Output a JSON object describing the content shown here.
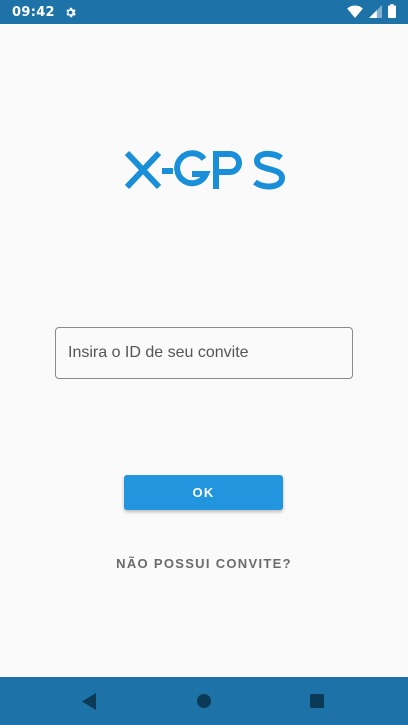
{
  "status_bar": {
    "time": "09:42",
    "icons": [
      "settings-icon",
      "wifi-icon",
      "signal-icon",
      "battery-icon"
    ]
  },
  "logo": {
    "text": "X-GPS",
    "color": "#1a8fd9"
  },
  "invite": {
    "placeholder": "Insira o ID de seu convite",
    "value": ""
  },
  "actions": {
    "ok_label": "OK",
    "no_invite_label": "NÃO POSSUI CONVITE?"
  },
  "nav_bar": {
    "icons": [
      "back-icon",
      "home-icon",
      "recents-icon"
    ]
  },
  "colors": {
    "primary_dark": "#1d72a8",
    "accent": "#2196de",
    "background": "#fafafa"
  }
}
